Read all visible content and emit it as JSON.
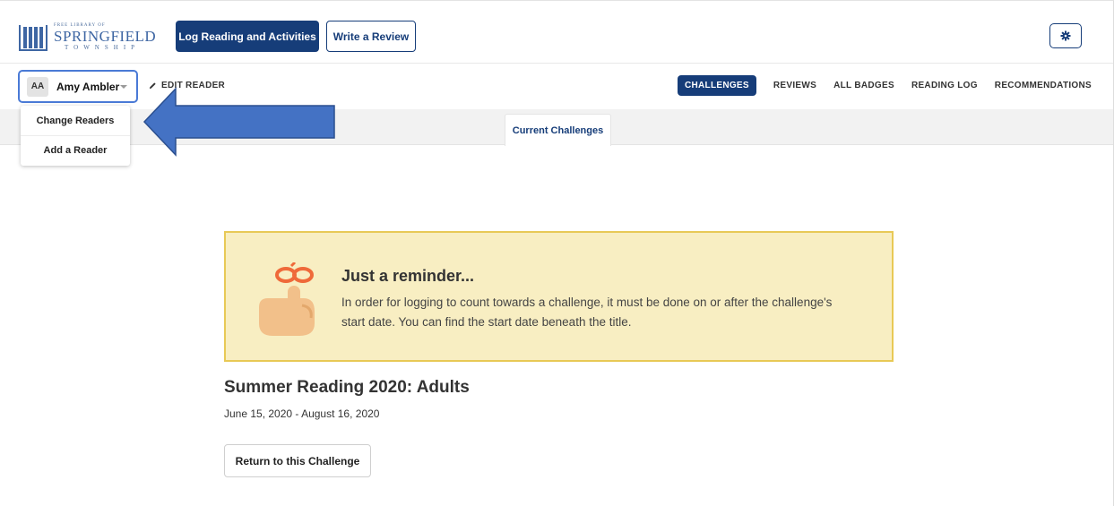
{
  "header": {
    "logo": {
      "small_text": "FREE LIBRARY OF",
      "main_text": "SPRINGFIELD",
      "sub_text": "TOWNSHIP"
    },
    "log_button_label": "Log Reading and Activities",
    "review_button_label": "Write a Review",
    "settings_icon": "gear-icon"
  },
  "reader": {
    "initials": "AA",
    "name": "Amy Ambler",
    "edit_label": "EDIT READER"
  },
  "nav": {
    "tabs": [
      {
        "label": "CHALLENGES",
        "active": true
      },
      {
        "label": "REVIEWS",
        "active": false
      },
      {
        "label": "ALL BADGES",
        "active": false
      },
      {
        "label": "READING LOG",
        "active": false
      },
      {
        "label": "RECOMMENDATIONS",
        "active": false
      }
    ]
  },
  "subtabs": {
    "current": "Current Challenges"
  },
  "dropdown": {
    "items": [
      "Change Readers",
      "Add a Reader"
    ]
  },
  "annotation": {
    "arrow_color": "#4472c4"
  },
  "reminder": {
    "title": "Just a reminder...",
    "text": "In order for logging to count towards a challenge, it must be done on or after the challenge's start date. You can find the start date beneath the title."
  },
  "challenge": {
    "title": "Summer Reading 2020: Adults",
    "dates": "June 15, 2020 - August 16, 2020",
    "return_label": "Return to this Challenge"
  },
  "colors": {
    "primary": "#163d79",
    "reminder_bg": "#f8eec2",
    "reminder_border": "#e8c956"
  }
}
